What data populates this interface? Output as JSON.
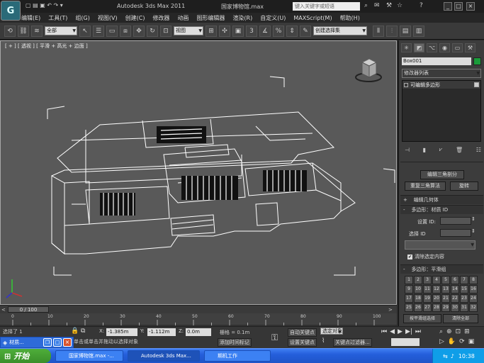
{
  "title_bar": {
    "app_title": "Autodesk 3ds Max  2011",
    "file_title": "国家博物馆.max",
    "search_placeholder": "键入关键字或短语",
    "help_icon": "?",
    "win_min": "_",
    "win_max": "□",
    "win_close": "×"
  },
  "app_logo": "G",
  "menu": [
    "编辑(E)",
    "工具(T)",
    "组(G)",
    "视图(V)",
    "创建(C)",
    "修改器",
    "动画",
    "图形编辑器",
    "渲染(R)",
    "自定义(U)",
    "MAXScript(M)",
    "帮助(H)"
  ],
  "toolbar": {
    "selection_filter": "全部",
    "coordinate_system": "视图",
    "named_selection": "创建选择集",
    "num_3": "3"
  },
  "viewport": {
    "label": "[ + ] [ 透视 ] [ 平滑 + 高光 + 边面 ]"
  },
  "command_panel": {
    "object_name": "Box001",
    "modifier_list": "修改器列表",
    "stack_item": "可编辑多边形",
    "btn_subdivide": "编辑三角剖分",
    "btn_retriangulate": "重复三角算法",
    "btn_rotate": "旋转",
    "rollout_edit_geometry": "编辑几何体",
    "rollout_material_ids": "多边形：材质 ID",
    "label_set_id": "设置 ID:",
    "label_select_id": "选择 ID",
    "checkbox_clear_selection": "清除选定内容",
    "rollout_smoothing": "多边形：平滑组",
    "smoothing_numbers": [
      "1",
      "2",
      "3",
      "4",
      "5",
      "6",
      "7",
      "8",
      "9",
      "10",
      "11",
      "12",
      "13",
      "14",
      "15",
      "16",
      "17",
      "18",
      "19",
      "20",
      "21",
      "22",
      "23",
      "24",
      "25",
      "26",
      "27",
      "28",
      "29",
      "30",
      "31",
      "32"
    ],
    "btn_select_by_sg": "按平滑组选择",
    "btn_clear_all": "清除全部"
  },
  "timeline": {
    "frame_counter": "0 / 100",
    "ticks": [
      "0",
      "10",
      "20",
      "30",
      "40",
      "50",
      "60",
      "70",
      "80",
      "90",
      "100"
    ]
  },
  "status": {
    "selected_count": "选择了 1",
    "prompt": "单击或单击并拖动以选择对象",
    "x_label": "X:",
    "x_value": "-1.385m",
    "y_label": "Y:",
    "y_value": "-1.112m",
    "z_label": "Z:",
    "z_value": "0.0m",
    "grid": "栅格 = 0.1m",
    "add_time_tag": "添加时间标记",
    "auto_key": "自动关键点",
    "set_key": "设置关键点",
    "selected_dropdown": "选定对象",
    "key_filters": "关键点过滤器..."
  },
  "mini_task": "材质...",
  "taskbar": {
    "start": "开始",
    "tasks": [
      "国家博物馆.max -...",
      "Autodesk 3ds Max...",
      "期机工作"
    ],
    "clock": "10:38"
  }
}
